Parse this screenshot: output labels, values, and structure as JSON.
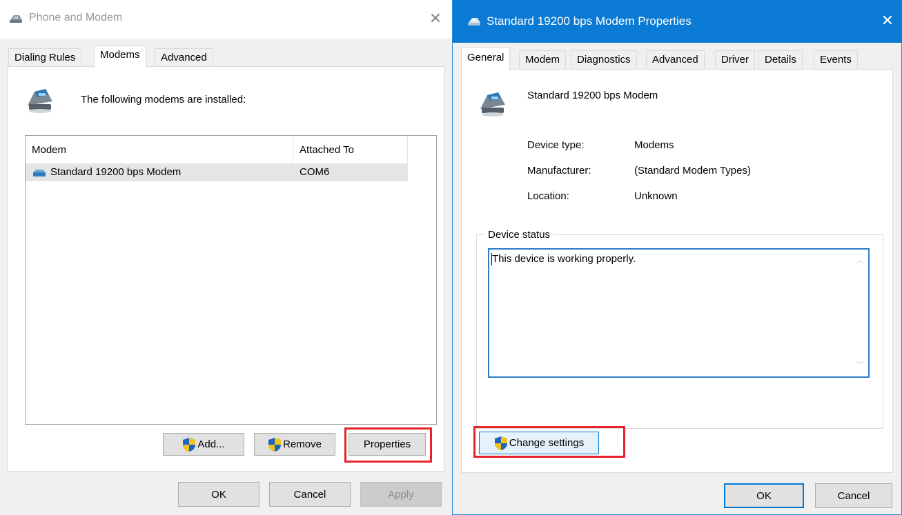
{
  "left_dialog": {
    "title": "Phone and Modem",
    "tabs": [
      "Dialing Rules",
      "Modems",
      "Advanced"
    ],
    "installed_text": "The following modems are installed:",
    "columns": [
      "Modem",
      "Attached To"
    ],
    "rows": [
      {
        "modem": "Standard 19200 bps Modem",
        "port": "COM6"
      }
    ],
    "buttons": {
      "add": "Add...",
      "remove": "Remove",
      "properties": "Properties"
    },
    "footer": {
      "ok": "OK",
      "cancel": "Cancel",
      "apply": "Apply"
    }
  },
  "right_dialog": {
    "title": "Standard 19200 bps Modem Properties",
    "tabs": [
      "General",
      "Modem",
      "Diagnostics",
      "Advanced",
      "Driver",
      "Details",
      "Events"
    ],
    "device_name": "Standard 19200 bps Modem",
    "info": {
      "device_type_label": "Device type:",
      "device_type_value": "Modems",
      "manufacturer_label": "Manufacturer:",
      "manufacturer_value": "(Standard Modem Types)",
      "location_label": "Location:",
      "location_value": "Unknown"
    },
    "status_group_label": "Device status",
    "status_text": "This device is working properly.",
    "change_settings": "Change settings",
    "footer": {
      "ok": "OK",
      "cancel": "Cancel"
    }
  },
  "colors": {
    "highlight": "#e8212a",
    "title_blue": "#0a7ad4",
    "focus_blue": "#0078d7"
  }
}
